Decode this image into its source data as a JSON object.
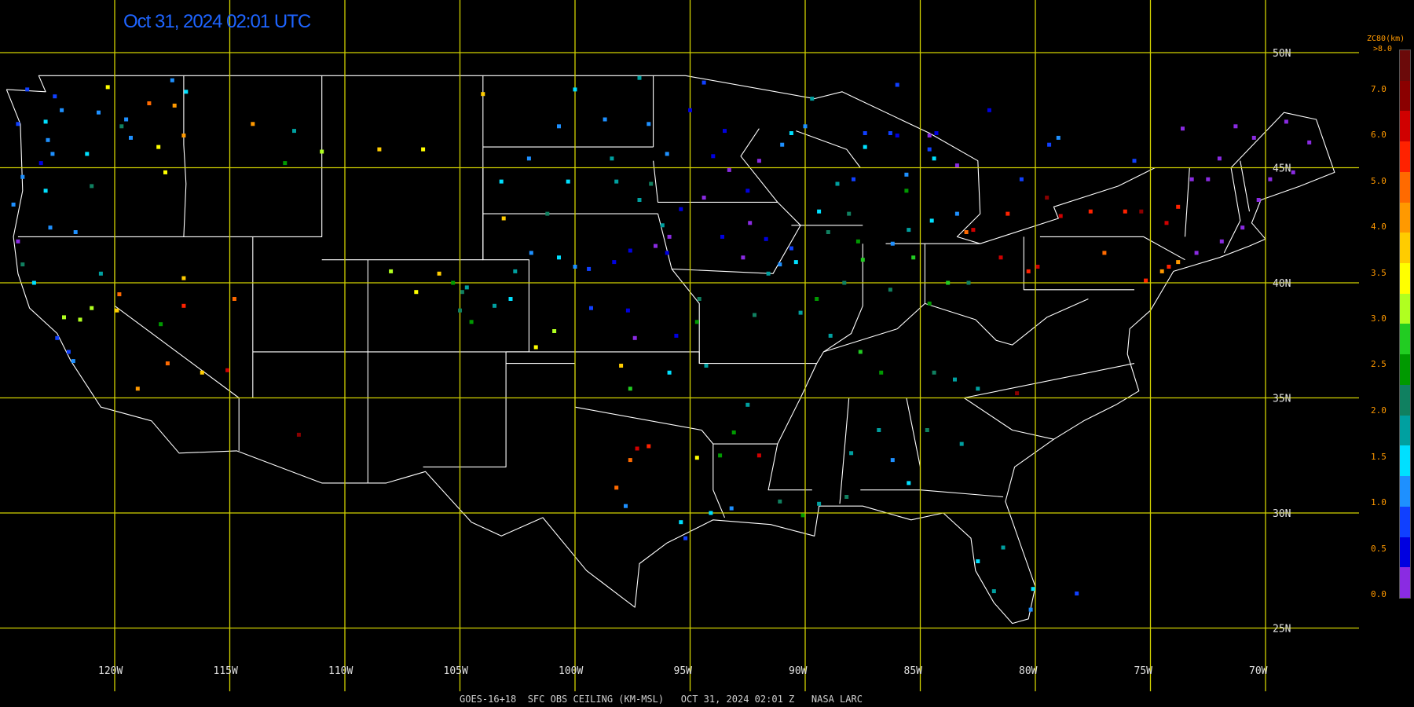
{
  "header": {
    "timestamp": "Oct 31, 2024 02:01 UTC"
  },
  "footer": {
    "caption": "GOES-16+18  SFC OBS CEILING (KM-MSL)   OCT 31, 2024 02:01 Z   NASA LARC"
  },
  "map": {
    "longitude_labels": [
      "120W",
      "115W",
      "110W",
      "105W",
      "100W",
      "95W",
      "90W",
      "85W",
      "80W",
      "75W",
      "70W"
    ],
    "latitude_labels": [
      "50N",
      "45N",
      "40N",
      "35N",
      "30N",
      "25N"
    ],
    "longitudes": [
      -120,
      -115,
      -110,
      -105,
      -100,
      -95,
      -90,
      -85,
      -80,
      -75,
      -70
    ],
    "latitudes": [
      50,
      45,
      40,
      35,
      30,
      25
    ],
    "extent": {
      "lon": [
        -125.7,
        -65.3
      ],
      "lat": [
        22.1,
        52.3
      ]
    },
    "grid_color": "#d2d200",
    "border_color": "#ffffff"
  },
  "colorbar": {
    "title": "ZC80(km)",
    "top_label": ">8.0",
    "labels": [
      "7.0",
      "6.0",
      "5.0",
      "4.0",
      "3.5",
      "3.0",
      "2.5",
      "2.0",
      "1.5",
      "1.0",
      "0.5",
      "0.0"
    ],
    "colors": [
      "#6b0a0a",
      "#8b0000",
      "#d00000",
      "#ff2200",
      "#ff6a00",
      "#ff9900",
      "#ffcc00",
      "#ffff00",
      "#b0ff20",
      "#22cc22",
      "#009900",
      "#108060",
      "#00a0a0",
      "#00e0ff",
      "#1e90ff",
      "#1040ff",
      "#0000e0",
      "#8a2be2"
    ],
    "color_indices_low_to_high": "colors listed top (high) to bottom (low)"
  },
  "observations": {
    "dots": [
      [
        -123.8,
        48.4,
        15
      ],
      [
        -122.3,
        47.5,
        14
      ],
      [
        -122.6,
        48.1,
        15
      ],
      [
        -123.0,
        47.0,
        13
      ],
      [
        -122.9,
        46.2,
        14
      ],
      [
        -122.7,
        45.6,
        14
      ],
      [
        -123.2,
        45.2,
        16
      ],
      [
        -121.2,
        45.6,
        13
      ],
      [
        -120.7,
        47.4,
        14
      ],
      [
        -119.5,
        47.1,
        14
      ],
      [
        -117.4,
        47.7,
        5
      ],
      [
        -117.0,
        46.4,
        5
      ],
      [
        -119.3,
        46.3,
        14
      ],
      [
        -121.0,
        44.2,
        11
      ],
      [
        -123.0,
        44.0,
        13
      ],
      [
        -124.0,
        44.6,
        14
      ],
      [
        -122.8,
        42.4,
        14
      ],
      [
        -121.7,
        42.2,
        14
      ],
      [
        -124.2,
        41.8,
        17
      ],
      [
        -123.5,
        40.0,
        13
      ],
      [
        -122.2,
        38.5,
        8
      ],
      [
        -121.5,
        38.4,
        8
      ],
      [
        -121.0,
        38.9,
        8
      ],
      [
        -122.5,
        37.6,
        15
      ],
      [
        -122.0,
        37.0,
        15
      ],
      [
        -121.8,
        36.6,
        14
      ],
      [
        -119.9,
        38.8,
        6
      ],
      [
        -118.0,
        38.2,
        10
      ],
      [
        -117.7,
        36.5,
        4
      ],
      [
        -116.2,
        36.1,
        6
      ],
      [
        -115.1,
        36.2,
        2
      ],
      [
        -119.0,
        35.4,
        5
      ],
      [
        -117.0,
        39.0,
        3
      ],
      [
        -112.0,
        33.4,
        1
      ],
      [
        -108.0,
        40.5,
        8
      ],
      [
        -106.9,
        39.6,
        7
      ],
      [
        -105.9,
        40.4,
        6
      ],
      [
        -105.3,
        40.0,
        10
      ],
      [
        -104.7,
        39.8,
        12
      ],
      [
        -104.9,
        39.6,
        11
      ],
      [
        -105.0,
        38.8,
        11
      ],
      [
        -104.5,
        38.3,
        10
      ],
      [
        -103.5,
        39.0,
        12
      ],
      [
        -102.8,
        39.3,
        13
      ],
      [
        -102.6,
        40.5,
        12
      ],
      [
        -101.9,
        41.3,
        14
      ],
      [
        -100.7,
        41.1,
        13
      ],
      [
        -100.0,
        40.7,
        14
      ],
      [
        -99.4,
        40.6,
        15
      ],
      [
        -98.3,
        40.9,
        16
      ],
      [
        -97.6,
        41.4,
        16
      ],
      [
        -96.5,
        41.6,
        17
      ],
      [
        -96.0,
        41.3,
        16
      ],
      [
        -95.9,
        42.0,
        17
      ],
      [
        -95.4,
        43.2,
        16
      ],
      [
        -94.4,
        43.7,
        17
      ],
      [
        -93.3,
        44.9,
        17
      ],
      [
        -92.5,
        44.0,
        16
      ],
      [
        -92.0,
        45.3,
        17
      ],
      [
        -91.0,
        46.0,
        14
      ],
      [
        -90.6,
        46.5,
        13
      ],
      [
        -90.0,
        46.8,
        14
      ],
      [
        -89.4,
        43.1,
        13
      ],
      [
        -88.1,
        43.0,
        11
      ],
      [
        -88.6,
        44.3,
        12
      ],
      [
        -87.9,
        44.5,
        15
      ],
      [
        -87.4,
        45.9,
        13
      ],
      [
        -85.6,
        44.7,
        14
      ],
      [
        -84.4,
        45.4,
        13
      ],
      [
        -84.6,
        46.4,
        17
      ],
      [
        -86.3,
        46.5,
        15
      ],
      [
        -93.5,
        46.6,
        16
      ],
      [
        -95.0,
        47.5,
        16
      ],
      [
        -96.8,
        46.9,
        14
      ],
      [
        -98.7,
        47.1,
        14
      ],
      [
        -100.7,
        46.8,
        14
      ],
      [
        -102.0,
        45.4,
        14
      ],
      [
        -103.2,
        44.4,
        13
      ],
      [
        -100.3,
        44.4,
        13
      ],
      [
        -98.2,
        44.4,
        12
      ],
      [
        -97.2,
        43.6,
        12
      ],
      [
        -96.7,
        44.3,
        11
      ],
      [
        -96.2,
        42.5,
        12
      ],
      [
        -93.6,
        42.0,
        16
      ],
      [
        -92.4,
        42.6,
        17
      ],
      [
        -91.7,
        41.9,
        16
      ],
      [
        -90.6,
        41.5,
        15
      ],
      [
        -91.1,
        40.8,
        14
      ],
      [
        -90.2,
        38.7,
        12
      ],
      [
        -92.2,
        38.6,
        11
      ],
      [
        -94.6,
        39.3,
        11
      ],
      [
        -94.7,
        38.3,
        10
      ],
      [
        -95.6,
        37.7,
        16
      ],
      [
        -97.4,
        37.6,
        17
      ],
      [
        -97.7,
        38.8,
        16
      ],
      [
        -99.3,
        38.9,
        15
      ],
      [
        -100.9,
        37.9,
        8
      ],
      [
        -101.7,
        37.2,
        7
      ],
      [
        -98.0,
        36.4,
        6
      ],
      [
        -97.6,
        35.4,
        9
      ],
      [
        -95.9,
        36.1,
        13
      ],
      [
        -94.3,
        36.4,
        12
      ],
      [
        -92.5,
        34.7,
        12
      ],
      [
        -93.1,
        33.5,
        10
      ],
      [
        -94.7,
        32.4,
        7
      ],
      [
        -96.8,
        32.9,
        3
      ],
      [
        -97.3,
        32.8,
        2
      ],
      [
        -97.6,
        32.3,
        4
      ],
      [
        -98.2,
        31.1,
        4
      ],
      [
        -97.8,
        30.3,
        14
      ],
      [
        -95.4,
        29.6,
        13
      ],
      [
        -94.1,
        30.0,
        13
      ],
      [
        -93.2,
        30.2,
        14
      ],
      [
        -95.2,
        28.9,
        15
      ],
      [
        -93.7,
        32.5,
        10
      ],
      [
        -92.0,
        32.5,
        2
      ],
      [
        -91.1,
        30.5,
        11
      ],
      [
        -90.1,
        29.9,
        10
      ],
      [
        -89.4,
        30.4,
        12
      ],
      [
        -88.2,
        30.7,
        11
      ],
      [
        -88.0,
        32.6,
        12
      ],
      [
        -86.8,
        33.6,
        12
      ],
      [
        -86.2,
        32.3,
        14
      ],
      [
        -85.5,
        31.3,
        13
      ],
      [
        -84.7,
        33.6,
        11
      ],
      [
        -83.2,
        33.0,
        12
      ],
      [
        -84.4,
        36.1,
        11
      ],
      [
        -86.7,
        36.1,
        10
      ],
      [
        -87.6,
        37.0,
        9
      ],
      [
        -88.9,
        37.7,
        12
      ],
      [
        -89.5,
        39.3,
        10
      ],
      [
        -88.3,
        40.0,
        11
      ],
      [
        -87.7,
        41.8,
        10
      ],
      [
        -85.3,
        41.1,
        9
      ],
      [
        -86.3,
        39.7,
        11
      ],
      [
        -84.6,
        39.1,
        10
      ],
      [
        -83.8,
        40.0,
        9
      ],
      [
        -82.9,
        40.0,
        11
      ],
      [
        -81.5,
        41.1,
        2
      ],
      [
        -80.3,
        40.5,
        3
      ],
      [
        -79.9,
        40.7,
        2
      ],
      [
        -77.0,
        41.3,
        4
      ],
      [
        -75.2,
        40.1,
        3
      ],
      [
        -74.2,
        40.7,
        3
      ],
      [
        -73.8,
        40.9,
        5
      ],
      [
        -73.0,
        41.3,
        17
      ],
      [
        -71.9,
        41.8,
        17
      ],
      [
        -71.0,
        42.4,
        17
      ],
      [
        -70.3,
        43.6,
        17
      ],
      [
        -69.8,
        44.5,
        17
      ],
      [
        -68.8,
        44.8,
        17
      ],
      [
        -68.1,
        46.1,
        17
      ],
      [
        -69.1,
        47.0,
        17
      ],
      [
        -70.5,
        46.3,
        17
      ],
      [
        -72.5,
        44.5,
        17
      ],
      [
        -73.2,
        44.5,
        17
      ],
      [
        -73.8,
        43.3,
        3
      ],
      [
        -74.3,
        42.6,
        2
      ],
      [
        -75.4,
        43.1,
        1
      ],
      [
        -76.1,
        43.1,
        3
      ],
      [
        -77.6,
        43.1,
        3
      ],
      [
        -78.9,
        42.9,
        2
      ],
      [
        -79.5,
        43.7,
        1
      ],
      [
        -81.2,
        43.0,
        3
      ],
      [
        -82.7,
        42.3,
        2
      ],
      [
        -83.0,
        42.2,
        4
      ],
      [
        -83.4,
        43.0,
        14
      ],
      [
        -84.5,
        42.7,
        13
      ],
      [
        -85.5,
        42.3,
        12
      ],
      [
        -86.2,
        41.7,
        14
      ],
      [
        -85.6,
        44.0,
        10
      ],
      [
        -84.6,
        45.8,
        15
      ],
      [
        -83.4,
        45.1,
        17
      ],
      [
        -86.0,
        46.4,
        16
      ],
      [
        -87.4,
        46.5,
        15
      ],
      [
        -89.7,
        48.0,
        12
      ],
      [
        -94.4,
        48.7,
        15
      ],
      [
        -97.2,
        48.9,
        12
      ],
      [
        -100.0,
        48.4,
        13
      ],
      [
        -104.0,
        48.2,
        6
      ],
      [
        -106.6,
        45.8,
        7
      ],
      [
        -108.5,
        45.8,
        6
      ],
      [
        -111.0,
        45.7,
        8
      ],
      [
        -112.6,
        45.2,
        10
      ],
      [
        -114.0,
        46.9,
        5
      ],
      [
        -112.2,
        46.6,
        12
      ],
      [
        -116.9,
        48.3,
        13
      ],
      [
        -117.5,
        48.8,
        14
      ],
      [
        -118.1,
        45.9,
        7
      ],
      [
        -117.8,
        44.8,
        7
      ],
      [
        -119.7,
        46.8,
        11
      ],
      [
        -118.5,
        47.8,
        4
      ],
      [
        -120.3,
        48.5,
        7
      ],
      [
        -124.2,
        46.9,
        15
      ],
      [
        -124.4,
        43.4,
        14
      ],
      [
        -124.0,
        40.8,
        11
      ],
      [
        -120.6,
        40.4,
        12
      ],
      [
        -119.8,
        39.5,
        4
      ],
      [
        -117.0,
        40.2,
        6
      ],
      [
        -114.8,
        39.3,
        4
      ],
      [
        -103.1,
        42.8,
        6
      ],
      [
        -101.2,
        43.0,
        11
      ],
      [
        -98.4,
        45.4,
        12
      ],
      [
        -96.0,
        45.6,
        14
      ],
      [
        -94.0,
        45.5,
        16
      ],
      [
        -92.7,
        41.1,
        17
      ],
      [
        -91.6,
        40.4,
        12
      ],
      [
        -90.4,
        40.9,
        13
      ],
      [
        -89.0,
        42.2,
        11
      ],
      [
        -87.5,
        41.0,
        9
      ],
      [
        -83.5,
        35.8,
        12
      ],
      [
        -82.5,
        35.4,
        12
      ],
      [
        -80.8,
        35.2,
        1
      ],
      [
        -80.2,
        25.8,
        14
      ],
      [
        -81.4,
        28.5,
        12
      ],
      [
        -82.5,
        27.9,
        13
      ],
      [
        -81.8,
        26.6,
        12
      ],
      [
        -80.1,
        26.7,
        13
      ],
      [
        -78.2,
        26.5,
        15
      ],
      [
        -74.5,
        40.5,
        5
      ],
      [
        -73.6,
        46.7,
        17
      ],
      [
        -71.3,
        46.8,
        17
      ],
      [
        -72.0,
        45.4,
        17
      ],
      [
        -75.7,
        45.3,
        15
      ],
      [
        -79.0,
        46.3,
        14
      ],
      [
        -82.0,
        47.5,
        16
      ],
      [
        -84.3,
        46.5,
        16
      ],
      [
        -86.0,
        48.6,
        15
      ],
      [
        -80.6,
        44.5,
        15
      ],
      [
        -79.4,
        46.0,
        15
      ]
    ]
  }
}
